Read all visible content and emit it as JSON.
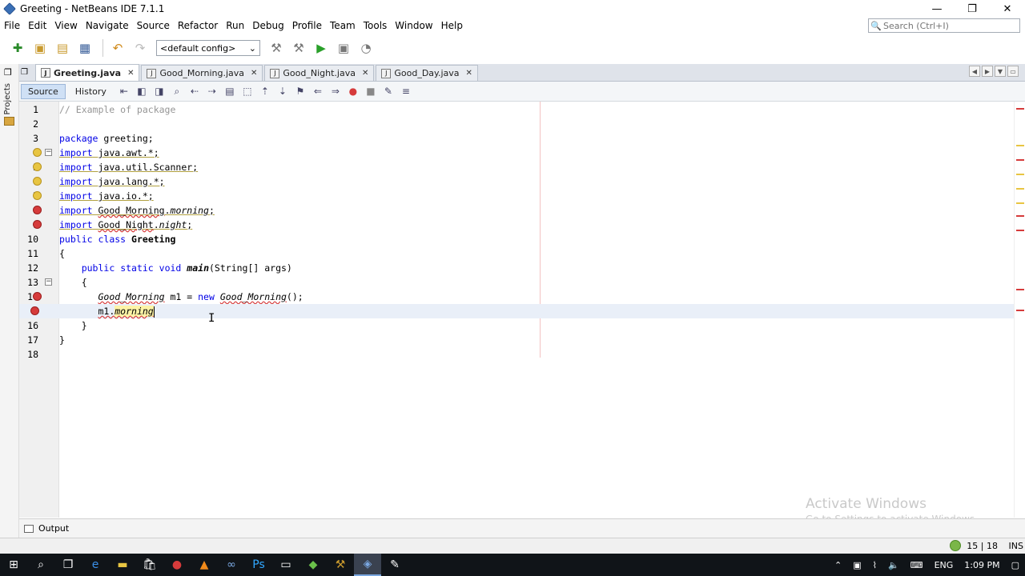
{
  "window": {
    "title": "Greeting - NetBeans IDE 7.1.1",
    "controls": [
      "—",
      "❐",
      "✕"
    ]
  },
  "menu": [
    "File",
    "Edit",
    "View",
    "Navigate",
    "Source",
    "Refactor",
    "Run",
    "Debug",
    "Profile",
    "Team",
    "Tools",
    "Window",
    "Help"
  ],
  "search": {
    "placeholder": "Search (Ctrl+I)"
  },
  "toolbar": {
    "config": "<default config>"
  },
  "sidebar": {
    "projects_label": "Projects"
  },
  "tabs": [
    {
      "label": "Greeting.java",
      "active": true
    },
    {
      "label": "Good_Morning.java",
      "active": false
    },
    {
      "label": "Good_Night.java",
      "active": false
    },
    {
      "label": "Good_Day.java",
      "active": false
    }
  ],
  "editor_toolbar": {
    "source": "Source",
    "history": "History"
  },
  "code": {
    "lines": [
      {
        "n": "1"
      },
      {
        "n": "2"
      },
      {
        "n": "3"
      },
      {
        "n": "4"
      },
      {
        "n": "5"
      },
      {
        "n": "6"
      },
      {
        "n": "7"
      },
      {
        "n": "8"
      },
      {
        "n": "9"
      },
      {
        "n": "10"
      },
      {
        "n": "11"
      },
      {
        "n": "12"
      },
      {
        "n": "13"
      },
      {
        "n": "14"
      },
      {
        "n": "15"
      },
      {
        "n": "16"
      },
      {
        "n": "17"
      },
      {
        "n": "18"
      }
    ],
    "t": {
      "comment": "// Example of package",
      "package_kw": "package",
      "package_name": " greeting;",
      "import_kw": "import",
      "imp1": " java.awt.*;",
      "imp2": " java.util.Scanner;",
      "imp3": " java.lang.*;",
      "imp4": " java.io.*;",
      "imp5_pkg": "Good_Morning",
      "imp5_cls": "morning",
      "imp6_pkg": "Good_Night",
      "imp6_cls": "night",
      "public_kw": "public",
      "class_kw": "class",
      "class_name": "Greeting",
      "open_brace": "{",
      "close_brace": "}",
      "static_void": "static void",
      "main_name": "main",
      "main_args": "(String[] args)",
      "type_gm": "Good_Morning",
      "var_m1": " m1 = ",
      "new_kw": "new",
      "ctor_gm": "Good_Morning",
      "ctor_end": "();",
      "m1_dot": "m1.",
      "morning_call": "morning"
    }
  },
  "output": {
    "label": "Output"
  },
  "status": {
    "position": "15 | 18",
    "mode": "INS"
  },
  "watermark": {
    "line1": "Activate Windows",
    "line2": "Go to Settings to activate Windows."
  },
  "taskbar": {
    "language": "ENG",
    "time": "1:09 PM"
  },
  "colors": {
    "keyword": "#0000e6",
    "comment": "#969696",
    "error": "#d63b3b",
    "warning": "#e8c542",
    "taskbar": "#101418"
  }
}
